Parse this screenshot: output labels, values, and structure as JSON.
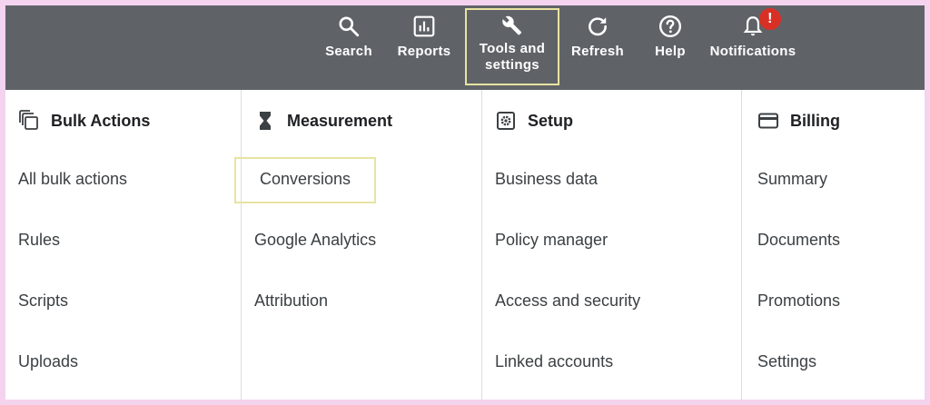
{
  "toolbar": {
    "search": {
      "label": "Search",
      "icon": "search-icon"
    },
    "reports": {
      "label": "Reports",
      "icon": "bar-chart-icon"
    },
    "tools": {
      "label_line1": "Tools and",
      "label_line2": "settings",
      "icon": "wrench-icon"
    },
    "refresh": {
      "label": "Refresh",
      "icon": "refresh-icon"
    },
    "help": {
      "label": "Help",
      "icon": "help-icon"
    },
    "notifications": {
      "label": "Notifications",
      "icon": "bell-icon",
      "badge": "!"
    }
  },
  "columns": [
    {
      "heading": "Bulk Actions",
      "icon": "bulk-actions-icon",
      "items": [
        "All bulk actions",
        "Rules",
        "Scripts",
        "Uploads"
      ]
    },
    {
      "heading": "Measurement",
      "icon": "hourglass-icon",
      "items": [
        "Conversions",
        "Google Analytics",
        "Attribution"
      ]
    },
    {
      "heading": "Setup",
      "icon": "settings-gear-icon",
      "items": [
        "Business data",
        "Policy manager",
        "Access and security",
        "Linked accounts"
      ]
    },
    {
      "heading": "Billing",
      "icon": "credit-card-icon",
      "items": [
        "Summary",
        "Documents",
        "Promotions",
        "Settings"
      ]
    }
  ],
  "colors": {
    "toolbar_bg": "#5f6368",
    "highlight": "#e8e3a1",
    "badge": "#d93025",
    "page_border": "#f3d3ee"
  }
}
